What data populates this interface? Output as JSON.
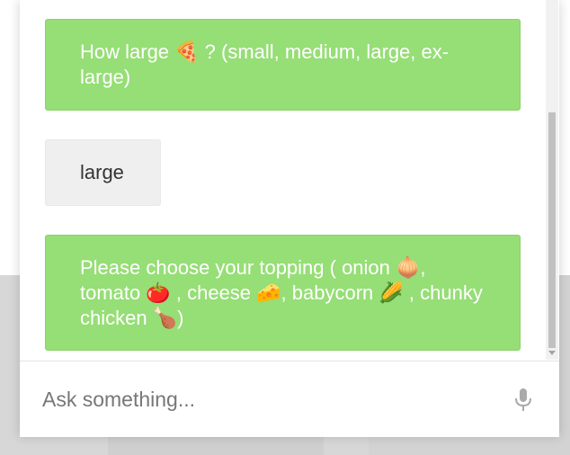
{
  "chat": {
    "messages": [
      {
        "sender": "bot",
        "text": "How large 🍕 ? (small, medium, large, ex-large)"
      },
      {
        "sender": "user",
        "text": "large"
      },
      {
        "sender": "bot",
        "text": "Please choose your topping ( onion 🧅, tomato 🍅 , cheese 🧀, babycorn 🌽 , chunky chicken 🍗)"
      }
    ]
  },
  "input": {
    "placeholder": "Ask something...",
    "value": ""
  },
  "icons": {
    "mic": "microphone-icon"
  },
  "colors": {
    "bot_bubble": "#96de76",
    "user_bubble": "#efefef",
    "bot_text": "#ffffff",
    "user_text": "#333333",
    "mic": "#aaaaaa"
  }
}
